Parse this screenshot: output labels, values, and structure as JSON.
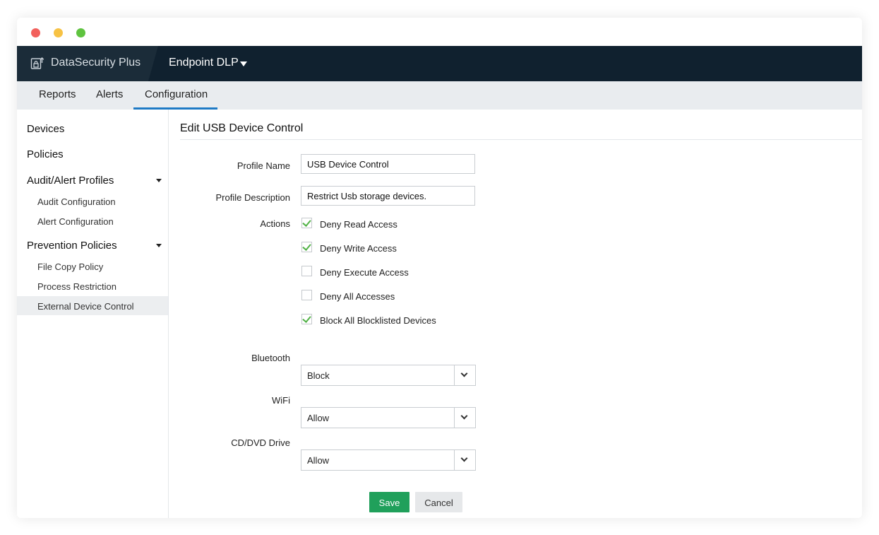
{
  "app": {
    "brand_name": "DataSecurity Plus",
    "brand_icon": "lock-monitor-icon",
    "module": "Endpoint DLP",
    "colors": {
      "topbar": "#10212f",
      "accent": "#1f7ac5",
      "save": "#20a05b",
      "check": "#52b247"
    }
  },
  "tabs": [
    {
      "label": "Reports"
    },
    {
      "label": "Alerts"
    },
    {
      "label": "Configuration",
      "active": true
    }
  ],
  "sidebar": {
    "devices": "Devices",
    "policies": "Policies",
    "audit_alert_profiles": "Audit/Alert Profiles",
    "audit_configuration": "Audit Configuration",
    "alert_configuration": "Alert Configuration",
    "prevention_policies": "Prevention Policies",
    "file_copy_policy": "File Copy Policy",
    "process_restriction": "Process Restriction",
    "external_device_control": "External Device Control"
  },
  "form": {
    "title": "Edit USB Device Control",
    "profile_name_label": "Profile Name",
    "profile_name_value": "USB Device Control",
    "profile_description_label": "Profile Description",
    "profile_description_value": "Restrict Usb storage devices.",
    "actions_label": "Actions",
    "actions": [
      {
        "label": "Deny Read Access",
        "checked": true
      },
      {
        "label": "Deny Write Access",
        "checked": true
      },
      {
        "label": "Deny Execute Access",
        "checked": false
      },
      {
        "label": "Deny All Accesses",
        "checked": false
      },
      {
        "label": "Block All Blocklisted Devices",
        "checked": true
      }
    ],
    "bluetooth_label": "Bluetooth",
    "bluetooth_value": "Block",
    "wifi_label": "WiFi",
    "wifi_value": "Allow",
    "cddvd_label": "CD/DVD Drive",
    "cddvd_value": "Allow",
    "save_label": "Save",
    "cancel_label": "Cancel"
  }
}
